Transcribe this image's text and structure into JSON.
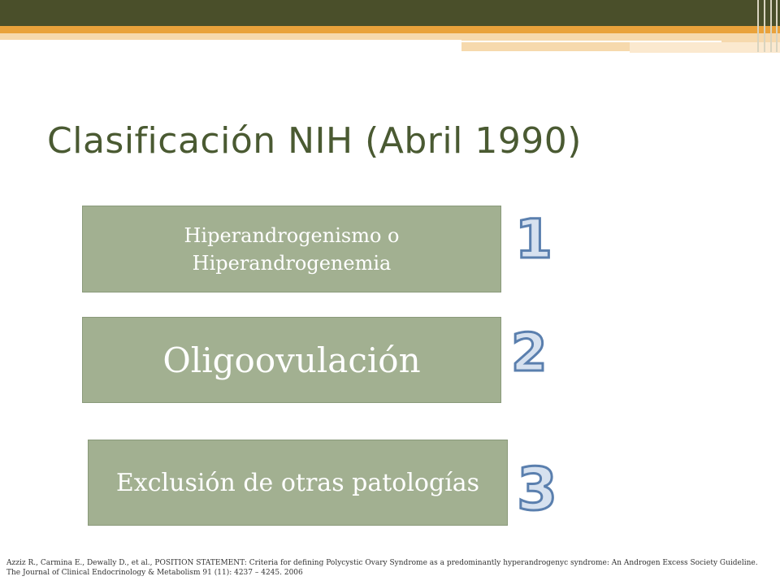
{
  "slide": {
    "title": "Clasificación NIH (Abril 1990)",
    "criteria": [
      {
        "number": "1",
        "text": "Hiperandrogenismo o Hiperandrogenemia"
      },
      {
        "number": "2",
        "text": "Oligoovulación"
      },
      {
        "number": "3",
        "text": "Exclusión de otras patologías"
      }
    ],
    "citation": "Azziz R., Carmina E., Dewally D., et al., POSITION STATEMENT: Criteria for defining Polycystic Ovary Syndrome as a predominantly hyperandrogenyc syndrome: An Androgen Excess Society Guideline. The Journal of Clinical Endocrinology & Metabolism 91 (11): 4237 – 4245. 2006"
  },
  "colors": {
    "banner_dark": "#4a4f2a",
    "banner_orange": "#e9a23b",
    "title": "#4a5a32",
    "box_fill": "#a2b091",
    "numeral_stroke": "#5a7fae"
  }
}
